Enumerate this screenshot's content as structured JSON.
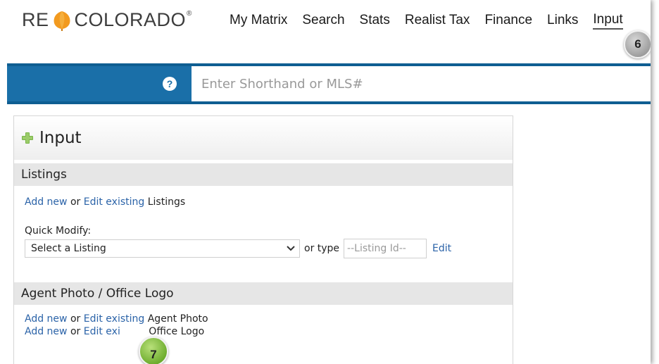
{
  "header": {
    "logo_left": "RE",
    "logo_right": "COLORADO",
    "logo_reg": "®",
    "nav": [
      "My Matrix",
      "Search",
      "Stats",
      "Realist Tax",
      "Finance",
      "Links",
      "Input"
    ]
  },
  "callouts": {
    "step6": "6",
    "step7": "7"
  },
  "searchbar": {
    "help_icon": "?",
    "placeholder": "Enter Shorthand or MLS#"
  },
  "panel": {
    "title": "Input",
    "listings": {
      "heading": "Listings",
      "add_new": "Add new",
      "or": "or",
      "edit_existing": "Edit existing",
      "suffix": "Listings",
      "quick_modify_label": "Quick Modify:",
      "select_value": "Select a Listing",
      "or_type": "or type",
      "listing_id_placeholder": "--Listing Id--",
      "edit": "Edit"
    },
    "agent": {
      "heading": "Agent Photo / Office Logo",
      "row1": {
        "add_new": "Add new",
        "or": "or",
        "edit_existing": "Edit existing",
        "suffix": "Agent Photo"
      },
      "row2": {
        "add_new": "Add new",
        "or": "or",
        "edit_existing": "Edit exi",
        "suffix": "Office Logo"
      }
    }
  },
  "colors": {
    "brand_blue": "#1a6fa8",
    "link": "#2b63a8",
    "callout_green": "#6aaa2a",
    "callout_gray": "#9a9a9a",
    "logo_orange": "#f29a1f"
  },
  "icons": {
    "logo": "aspen-leaf-icon",
    "help": "question-circle-icon",
    "panel": "plus-icon",
    "dropdown": "chevron-down-icon"
  }
}
